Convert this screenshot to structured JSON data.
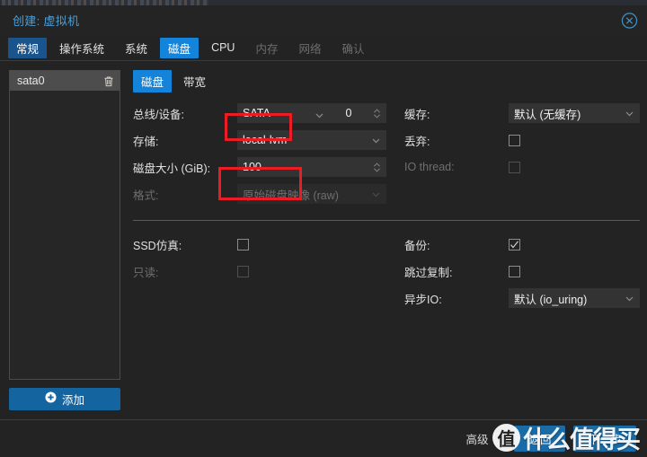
{
  "window": {
    "title": "创建: 虚拟机",
    "close_icon": "close-circle-icon"
  },
  "tabs": [
    {
      "label": "常规",
      "state": "selected-dark"
    },
    {
      "label": "操作系统",
      "state": "normal"
    },
    {
      "label": "系统",
      "state": "normal"
    },
    {
      "label": "磁盘",
      "state": "selected-bright"
    },
    {
      "label": "CPU",
      "state": "normal"
    },
    {
      "label": "内存",
      "state": "disabled"
    },
    {
      "label": "网络",
      "state": "disabled"
    },
    {
      "label": "确认",
      "state": "disabled"
    }
  ],
  "device_list": {
    "items": [
      {
        "name": "sata0",
        "delete_icon": "trash-icon",
        "selected": true
      }
    ],
    "add_button": {
      "label": "添加",
      "icon": "plus-circle-icon"
    }
  },
  "subtabs": [
    {
      "label": "磁盘",
      "selected": true
    },
    {
      "label": "带宽",
      "selected": false
    }
  ],
  "form": {
    "left": {
      "bus_device": {
        "label": "总线/设备:",
        "value": "SATA",
        "index_value": "0",
        "caret_icon": "chevron-down-icon",
        "spinner_icon": "spinner-updown-icon",
        "highlighted": true
      },
      "storage": {
        "label": "存储:",
        "value": "local-lvm",
        "caret_icon": "chevron-down-icon"
      },
      "disk_size": {
        "label": "磁盘大小 (GiB):",
        "value": "100",
        "spinner_icon": "spinner-updown-icon",
        "highlighted": true
      },
      "format": {
        "label": "格式:",
        "value": "原始磁盘映像 (raw)",
        "caret_icon": "chevron-down-icon",
        "disabled": true
      },
      "ssd_emulation": {
        "label": "SSD仿真:",
        "checked": false
      },
      "readonly": {
        "label": "只读:",
        "checked": false,
        "disabled": true
      }
    },
    "right": {
      "cache": {
        "label": "缓存:",
        "value": "默认 (无缓存)",
        "caret_icon": "chevron-down-icon"
      },
      "discard": {
        "label": "丢弃:",
        "checked": false
      },
      "io_thread": {
        "label": "IO thread:",
        "checked": false,
        "disabled": true
      },
      "backup": {
        "label": "备份:",
        "checked": true
      },
      "skip_replication": {
        "label": "跳过复制:",
        "checked": false
      },
      "async_io": {
        "label": "异步IO:",
        "value": "默认 (io_uring)",
        "caret_icon": "chevron-down-icon"
      }
    }
  },
  "footer": {
    "advanced": {
      "label": "高级",
      "checked": false
    },
    "back_button": "返回",
    "next_button": "下一步"
  },
  "watermark": {
    "badge": "值",
    "text": "什么值得买"
  },
  "colors": {
    "accent_bright": "#1384d9",
    "accent_dark": "#19548c",
    "button_blue": "#1a6ca8",
    "annotation_red": "#ec1c24",
    "title_blue": "#4a9fd8",
    "panel_bg": "#232323",
    "field_bg": "#333333"
  }
}
